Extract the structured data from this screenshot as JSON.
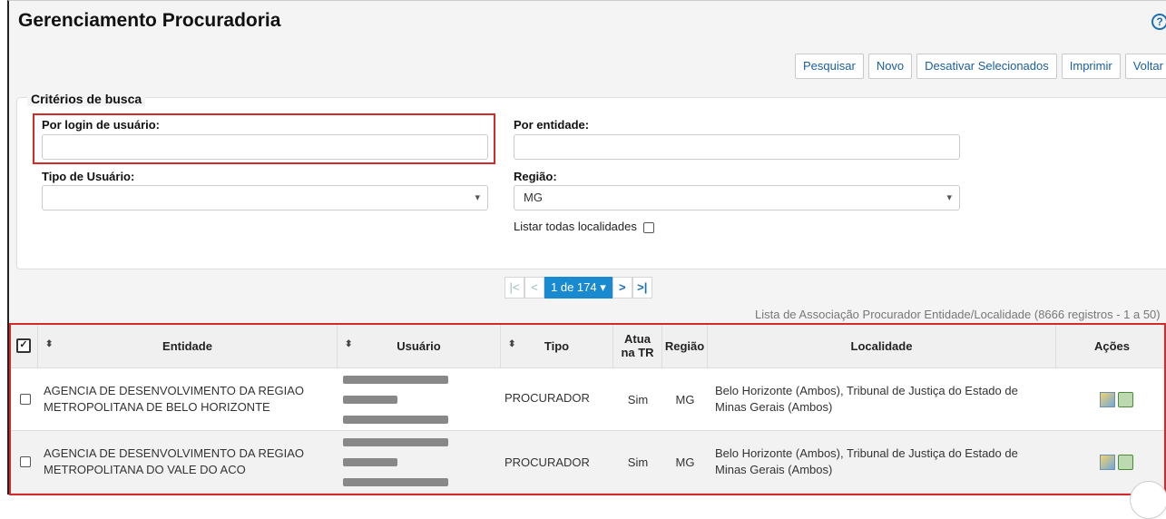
{
  "page": {
    "title": "Gerenciamento Procuradoria",
    "help_icon": "question-circle-icon",
    "help_glyph": "?"
  },
  "toolbar": {
    "pesquisar": "Pesquisar",
    "novo": "Novo",
    "desativar": "Desativar Selecionados",
    "imprimir": "Imprimir",
    "voltar": "Voltar"
  },
  "search": {
    "legend": "Critérios de busca",
    "login_label": "Por login de usuário:",
    "login_value": "",
    "entidade_label": "Por entidade:",
    "entidade_value": "",
    "tipo_label": "Tipo de Usuário:",
    "tipo_value": "",
    "regiao_label": "Região:",
    "regiao_value": "MG",
    "listar_label": "Listar todas localidades"
  },
  "pagination": {
    "first": "|<",
    "prev": "<",
    "current": "1 de 174 ▾",
    "next": ">",
    "last": ">|"
  },
  "records": {
    "summary": "Lista de Associação Procurador Entidade/Localidade (8666 registros - 1 a 50)"
  },
  "table": {
    "headers": {
      "entidade": "Entidade",
      "usuario": "Usuário",
      "tipo": "Tipo",
      "atua": "Atua na TR",
      "regiao": "Região",
      "localidade": "Localidade",
      "acoes": "Ações"
    },
    "rows": [
      {
        "entidade": "AGENCIA DE DESENVOLVIMENTO DA REGIAO METROPOLITANA DE BELO HORIZONTE",
        "tipo": "PROCURADOR",
        "atua": "Sim",
        "regiao": "MG",
        "localidade": "Belo Horizonte (Ambos), Tribunal de Justiça do Estado de Minas Gerais (Ambos)"
      },
      {
        "entidade": "AGENCIA DE DESENVOLVIMENTO DA REGIAO METROPOLITANA DO VALE DO ACO",
        "tipo": "PROCURADOR",
        "atua": "Sim",
        "regiao": "MG",
        "localidade": "Belo Horizonte (Ambos), Tribunal de Justiça do Estado de Minas Gerais (Ambos)"
      }
    ]
  },
  "colors": {
    "accent": "#1a8ad0",
    "link": "#1a5fa0",
    "highlight": "#d32a2a"
  }
}
